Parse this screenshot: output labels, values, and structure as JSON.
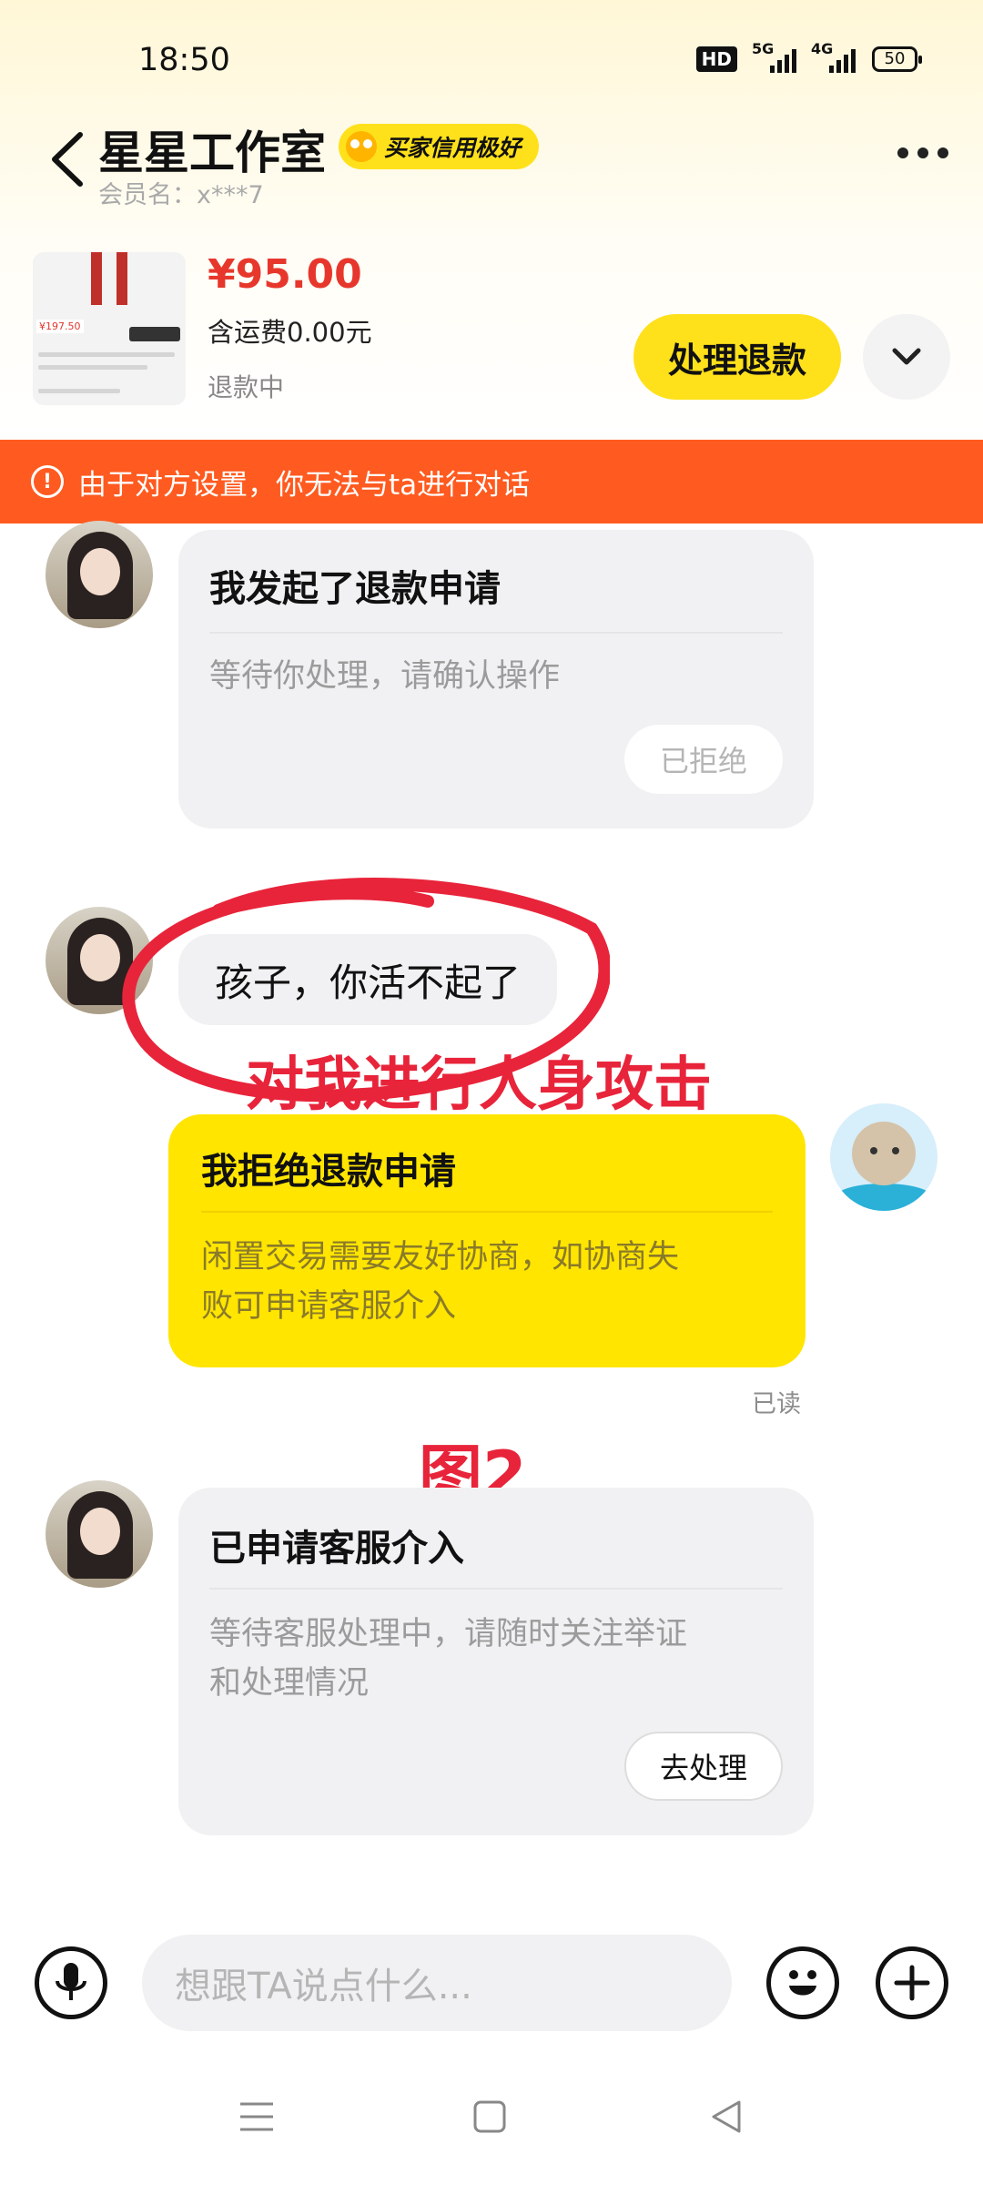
{
  "status_bar": {
    "time": "18:50",
    "hd": "HD",
    "net1": "5G",
    "net2": "4G",
    "battery": "50"
  },
  "header": {
    "title": "星星工作室",
    "badge": "买家信用极好",
    "member": "会员名：x***7"
  },
  "product": {
    "price": "¥95.00",
    "shipping": "含运费0.00元",
    "status": "退款中",
    "thumb_price": "¥197.50",
    "action_button": "处理退款"
  },
  "warning": {
    "text": "由于对方设置，你无法与ta进行对话"
  },
  "messages": {
    "refund_request": {
      "title": "我发起了退款申请",
      "body": "等待你处理，请确认操作",
      "button": "已拒绝"
    },
    "text_message": "孩子，你活不起了",
    "reject": {
      "title": "我拒绝退款申请",
      "body_line1": "闲置交易需要友好协商，如协商失",
      "body_line2": "败可申请客服介入",
      "read": "已读"
    },
    "service": {
      "title": "已申请客服介入",
      "body_line1": "等待客服处理中，请随时关注举证",
      "body_line2": "和处理情况",
      "button": "去处理"
    }
  },
  "annotations": {
    "attack": "对我进行人身攻击",
    "figure": "图2"
  },
  "input_bar": {
    "placeholder": "想跟TA说点什么..."
  },
  "colors": {
    "accent": "#ffe11b",
    "warning": "#ff5a1f",
    "price": "#e7372c",
    "annotation": "#e8243a"
  }
}
